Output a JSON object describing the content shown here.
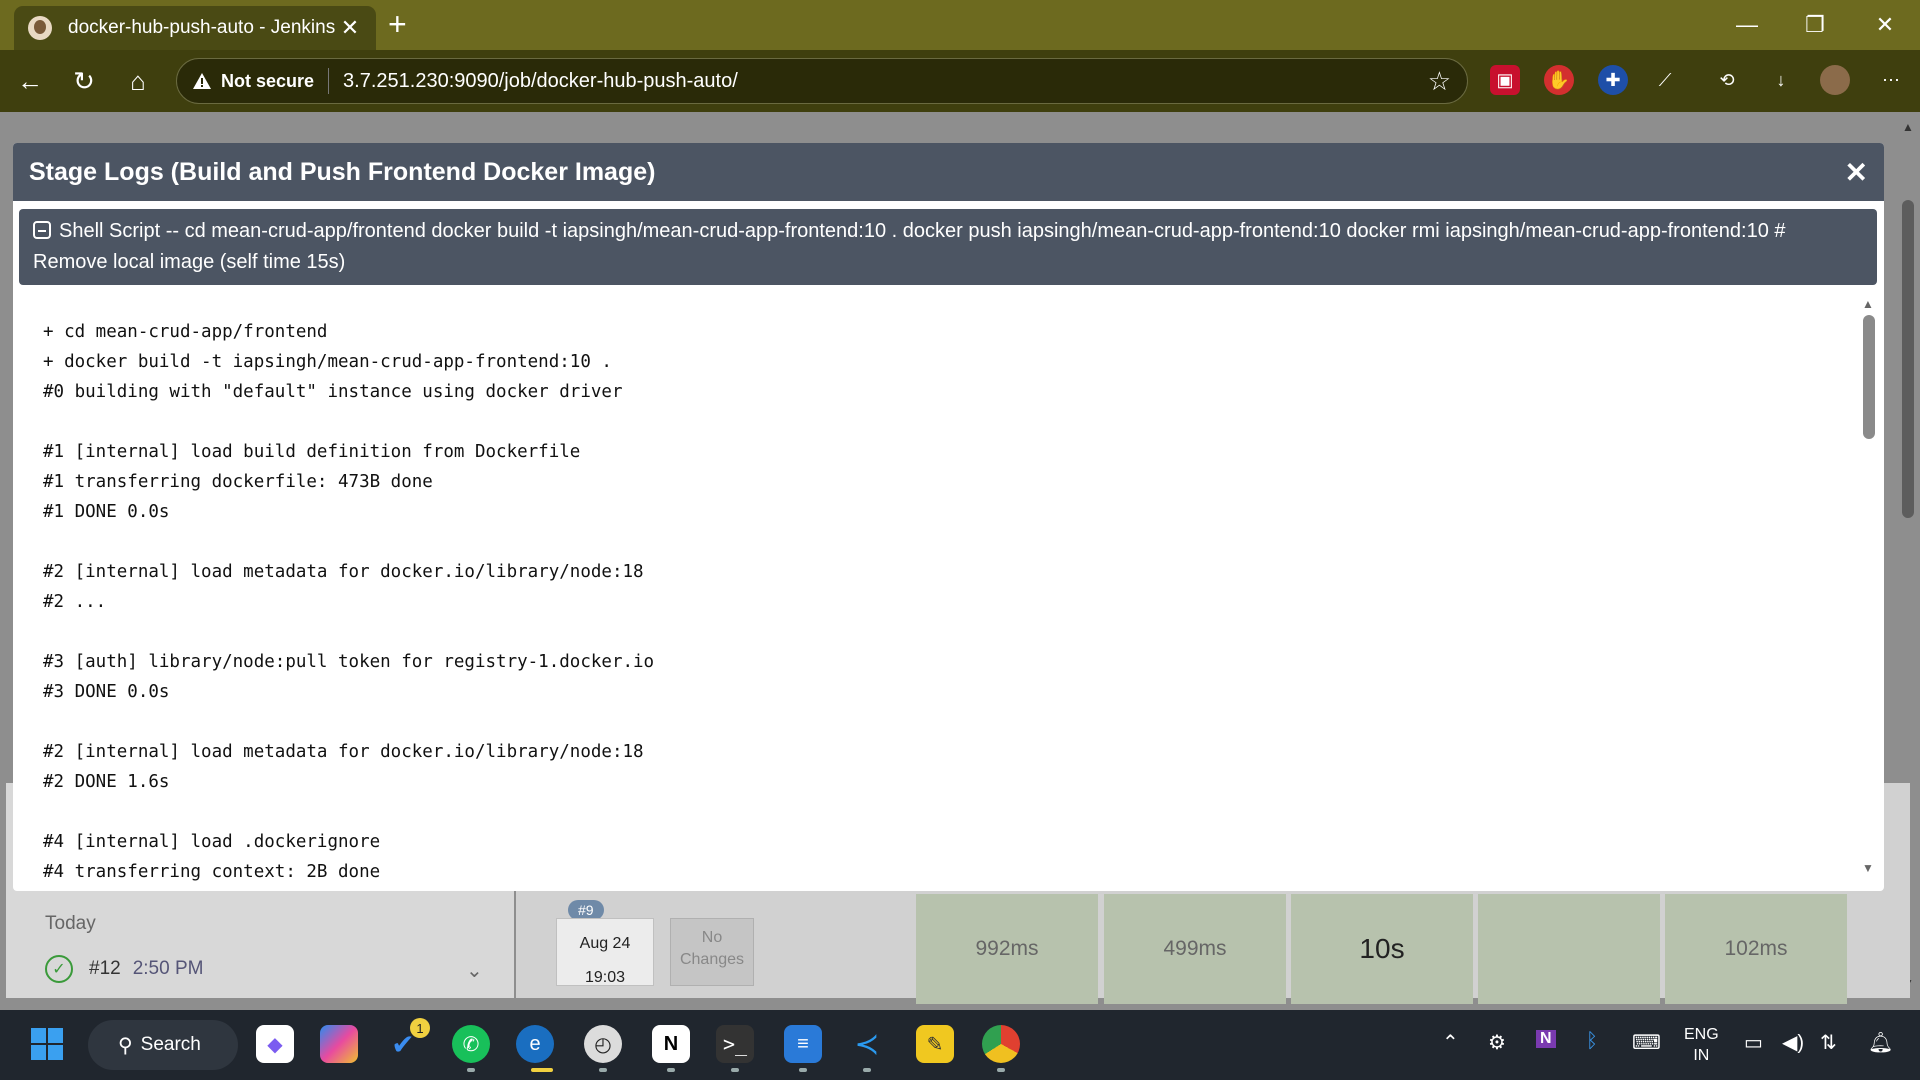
{
  "browser": {
    "tab_title": "docker-hub-push-auto - Jenkins",
    "tab_close": "✕",
    "new_tab": "+",
    "not_secure": "Not secure",
    "url": "3.7.251.230:9090/job/docker-hub-push-auto/",
    "window": {
      "minimize": "—",
      "restore": "❐",
      "close": "✕"
    }
  },
  "modal": {
    "title": "Stage Logs (Build and Push Frontend Docker Image)",
    "close": "✕",
    "step_header": "Shell Script -- cd mean-crud-app/frontend docker build -t iapsingh/mean-crud-app-frontend:10 . docker push iapsingh/mean-crud-app-frontend:10 docker rmi iapsingh/mean-crud-app-frontend:10 # Remove local image (self time 15s)",
    "log_lines": [
      "+ cd mean-crud-app/frontend",
      "+ docker build -t iapsingh/mean-crud-app-frontend:10 .",
      "#0 building with \"default\" instance using docker driver",
      "",
      "#1 [internal] load build definition from Dockerfile",
      "#1 transferring dockerfile: 473B done",
      "#1 DONE 0.0s",
      "",
      "#2 [internal] load metadata for docker.io/library/node:18",
      "#2 ...",
      "",
      "#3 [auth] library/node:pull token for registry-1.docker.io",
      "#3 DONE 0.0s",
      "",
      "#2 [internal] load metadata for docker.io/library/node:18",
      "#2 DONE 1.6s",
      "",
      "#4 [internal] load .dockerignore",
      "#4 transferring context: 2B done"
    ]
  },
  "background": {
    "today": "Today",
    "build_number": "#12",
    "build_time": "2:50 PM",
    "run_badge": "#9",
    "run_date": "Aug 24",
    "run_time": "19:03",
    "no_changes": "No Changes",
    "stage_times": [
      "992ms",
      "499ms",
      "10s",
      "",
      "102ms"
    ]
  },
  "taskbar": {
    "search": "Search",
    "lang_top": "ENG",
    "lang_bottom": "IN",
    "badge_count": "1"
  },
  "colors": {
    "tabbar": "#6d6a1f",
    "modal_header": "#4c5563",
    "stage_success": "#b7c2ad"
  }
}
